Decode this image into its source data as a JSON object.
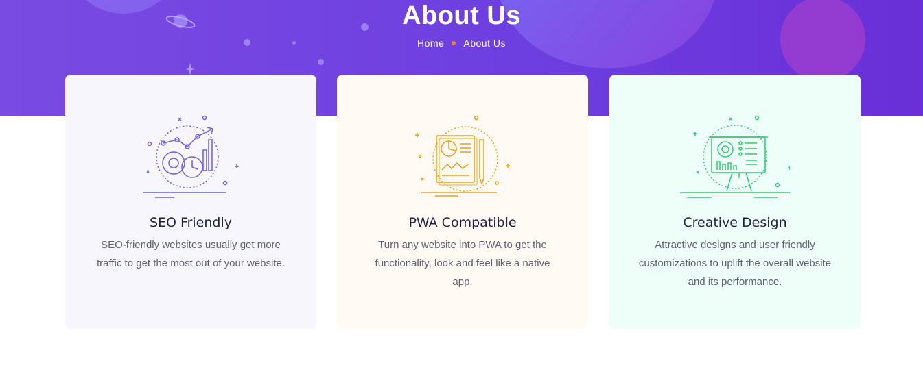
{
  "header": {
    "title": "About Us",
    "breadcrumb": {
      "home": "Home",
      "current": "About Us"
    }
  },
  "features": [
    {
      "title": "SEO Friendly",
      "description": "SEO-friendly websites usually get more traffic to get the most out of your website.",
      "icon": "seo-analytics-icon",
      "accent": "#6c5ce7",
      "background": "#f7f6fd"
    },
    {
      "title": "PWA Compatible",
      "description": "Turn any website into PWA to get the functionality, look and feel like a native app.",
      "icon": "report-document-icon",
      "accent": "#f39c12",
      "background": "#fffaf3"
    },
    {
      "title": "Creative Design",
      "description": "Attractive designs and user friendly customizations to uplift the overall website and its performance.",
      "icon": "presentation-board-icon",
      "accent": "#2ecc71",
      "background": "#eefef9"
    }
  ],
  "colors": {
    "hero": "#6d3fe0",
    "separator_dot": "#ff7a2d"
  }
}
